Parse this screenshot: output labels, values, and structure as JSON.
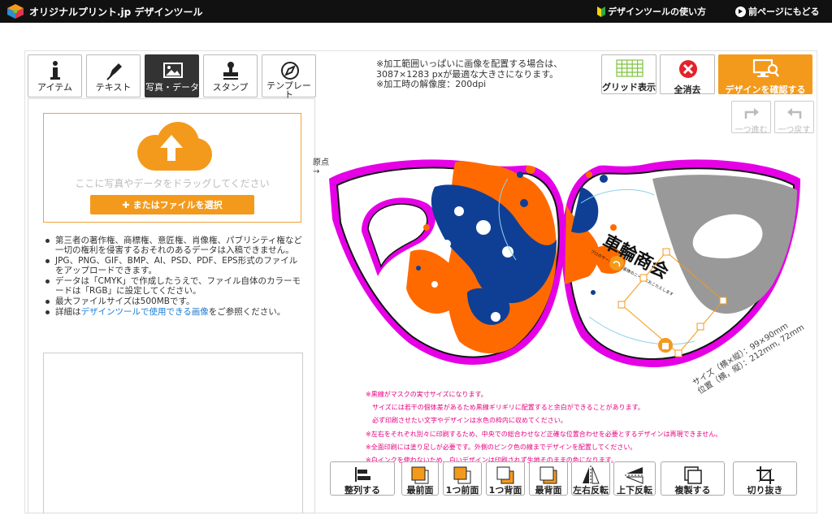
{
  "header": {
    "title": "オリジナルプリント.jp デザインツール",
    "guide_link": "デザインツールの使い方",
    "back_link": "前ページにもどる"
  },
  "tabs": [
    {
      "label": "アイテム",
      "icon": "info-icon"
    },
    {
      "label": "テキスト",
      "icon": "pen-icon"
    },
    {
      "label": "写真・データ",
      "icon": "image-icon",
      "active": true
    },
    {
      "label": "スタンプ",
      "icon": "stamp-icon"
    },
    {
      "label": "テンプレート",
      "icon": "compass-icon"
    }
  ],
  "upload": {
    "drop_text": "ここに写真やデータをドラッグしてください",
    "file_button": "またはファイルを選択"
  },
  "notes": [
    "第三者の著作権、商標権、意匠権、肖像権、パブリシティ権など一切の権利を侵害するおそれのあるデータは入稿できません。",
    "JPG、PNG、GIF、BMP、AI、PSD、PDF、EPS形式のファイルをアップロードできます。",
    "データは「CMYK」で作成したうえで、ファイル自体のカラーモードは「RGB」に設定してください。",
    "最大ファイルサイズは500MBです。"
  ],
  "notes_last": {
    "prefix": "詳細は",
    "link": "デザインツールで使用できる画像",
    "suffix": "をご参照ください。"
  },
  "notice": {
    "line1": "※加工範囲いっぱいに画像を配置する場合は、",
    "line2": "3087×1283 pxが最適な大きさになります。",
    "line3": "※加工時の解像度：200dpi"
  },
  "tools": {
    "grid": "グリッド表示",
    "clear": "全消去",
    "confirm": "デザインを確認する",
    "redo": "一つ進む",
    "undo": "一つ戻す"
  },
  "canvas": {
    "origin_label": "原点",
    "size_line": "サイズ（横×縦）：99×90mm",
    "pos_line": "位置（横，縦）：212mm, 72mm",
    "logo_text": "車輪商会",
    "logo_sub": "プロのサービスがお客様のニーズにおこたえします"
  },
  "pink_notes": [
    "※黒線がマスクの実寸サイズになります。",
    "　サイズには若干の個体差があるため黒線ギリギリに配置すると余白ができることがあります。",
    "　必ず印刷させたい文字やデザインは水色の枠内に収めてください。",
    "※左右をそれぞれ別々に印刷するため、中央での総合わせなど正確な位置合わせを必要とするデザインは再現できません。",
    "※全面印刷には塗り足しが必要です。外側のピンク色の線までデザインを配置してください。",
    "※白インクを使わないため、白いデザインは印刷されず生地そのままの色になります。"
  ],
  "bottom_tools": [
    "整列する",
    "最前面",
    "1つ前面",
    "1つ背面",
    "最背面",
    "左右反転",
    "上下反転",
    "複製する",
    "切り抜き"
  ],
  "colors": {
    "accent": "#f39a1c",
    "header_bg": "#111111",
    "mask_outline": "#e600e6",
    "splash_orange": "#ff6a00",
    "splash_blue": "#0f3f95"
  }
}
